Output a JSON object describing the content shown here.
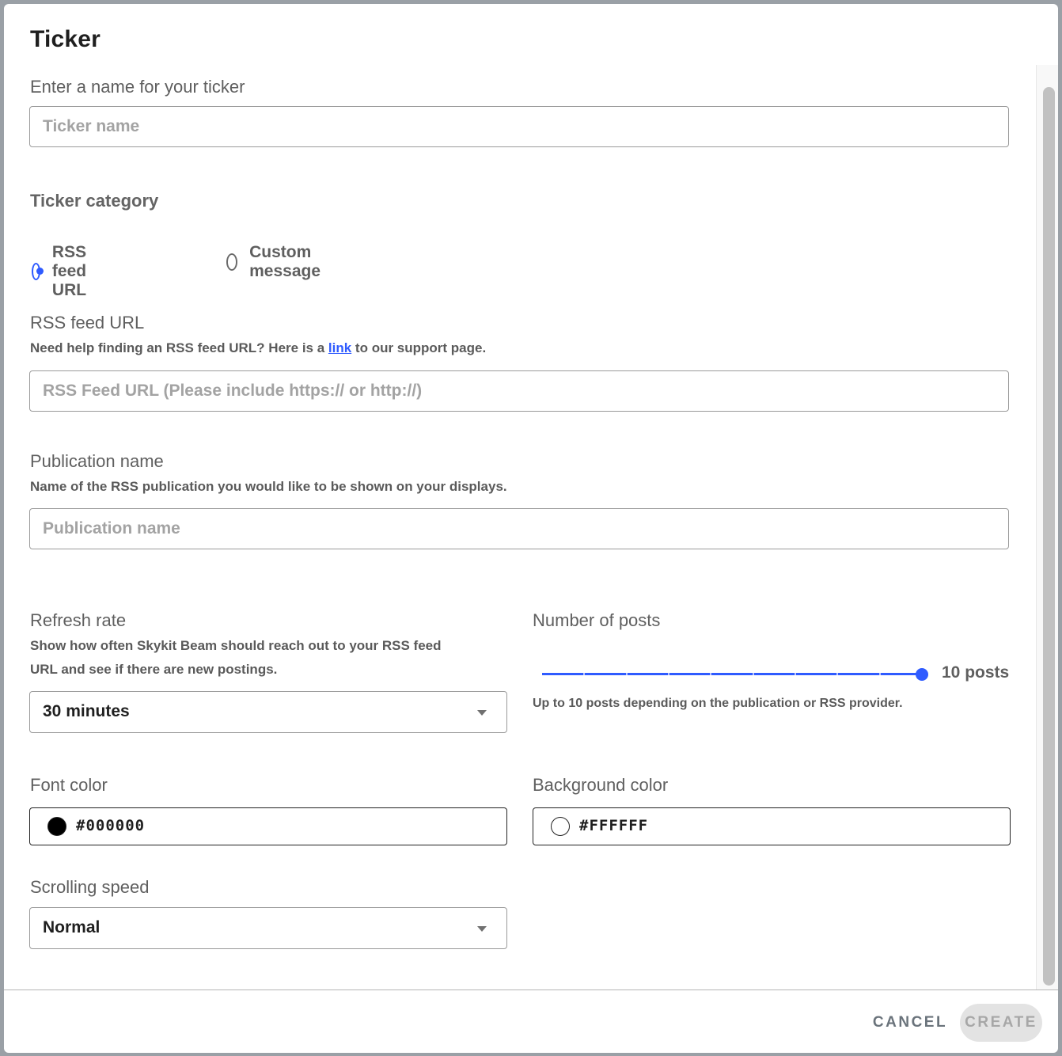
{
  "dialog": {
    "title": "Ticker"
  },
  "ticker_name": {
    "label": "Enter a name for your ticker",
    "value": "",
    "placeholder": "Ticker name"
  },
  "category": {
    "label": "Ticker category",
    "options": [
      {
        "label": "RSS feed URL",
        "selected": true
      },
      {
        "label": "Custom message",
        "selected": false
      }
    ]
  },
  "rss_url": {
    "label": "RSS feed URL",
    "help_prefix": "Need help finding an RSS feed URL? Here is a ",
    "help_link": "link",
    "help_suffix": " to our support page.",
    "value": "",
    "placeholder": "RSS Feed URL (Please include https:// or http://)"
  },
  "publication": {
    "label": "Publication name",
    "help": "Name of the RSS publication you would like to be shown on your displays.",
    "value": "",
    "placeholder": "Publication name"
  },
  "refresh_rate": {
    "label": "Refresh rate",
    "help_line1": "Show how often Skykit Beam should reach out to your RSS feed",
    "help_line2": "URL and see if there are new postings.",
    "selected": "30 minutes"
  },
  "posts": {
    "label": "Number of posts",
    "min": 1,
    "max": 10,
    "value": 10,
    "value_label": "10 posts",
    "help": "Up to 10 posts depending on the publication or RSS provider."
  },
  "font_color": {
    "label": "Font color",
    "value": "#000000",
    "swatch": "#000000"
  },
  "background_color": {
    "label": "Background color",
    "value": "#FFFFFF",
    "swatch": "#FFFFFF"
  },
  "scrolling_speed": {
    "label": "Scrolling speed",
    "selected": "Normal"
  },
  "footer": {
    "cancel_label": "CANCEL",
    "create_label": "CREATE",
    "create_enabled": false
  },
  "colors": {
    "accent": "#2f5bff",
    "backdrop": "#9aa0a6"
  }
}
